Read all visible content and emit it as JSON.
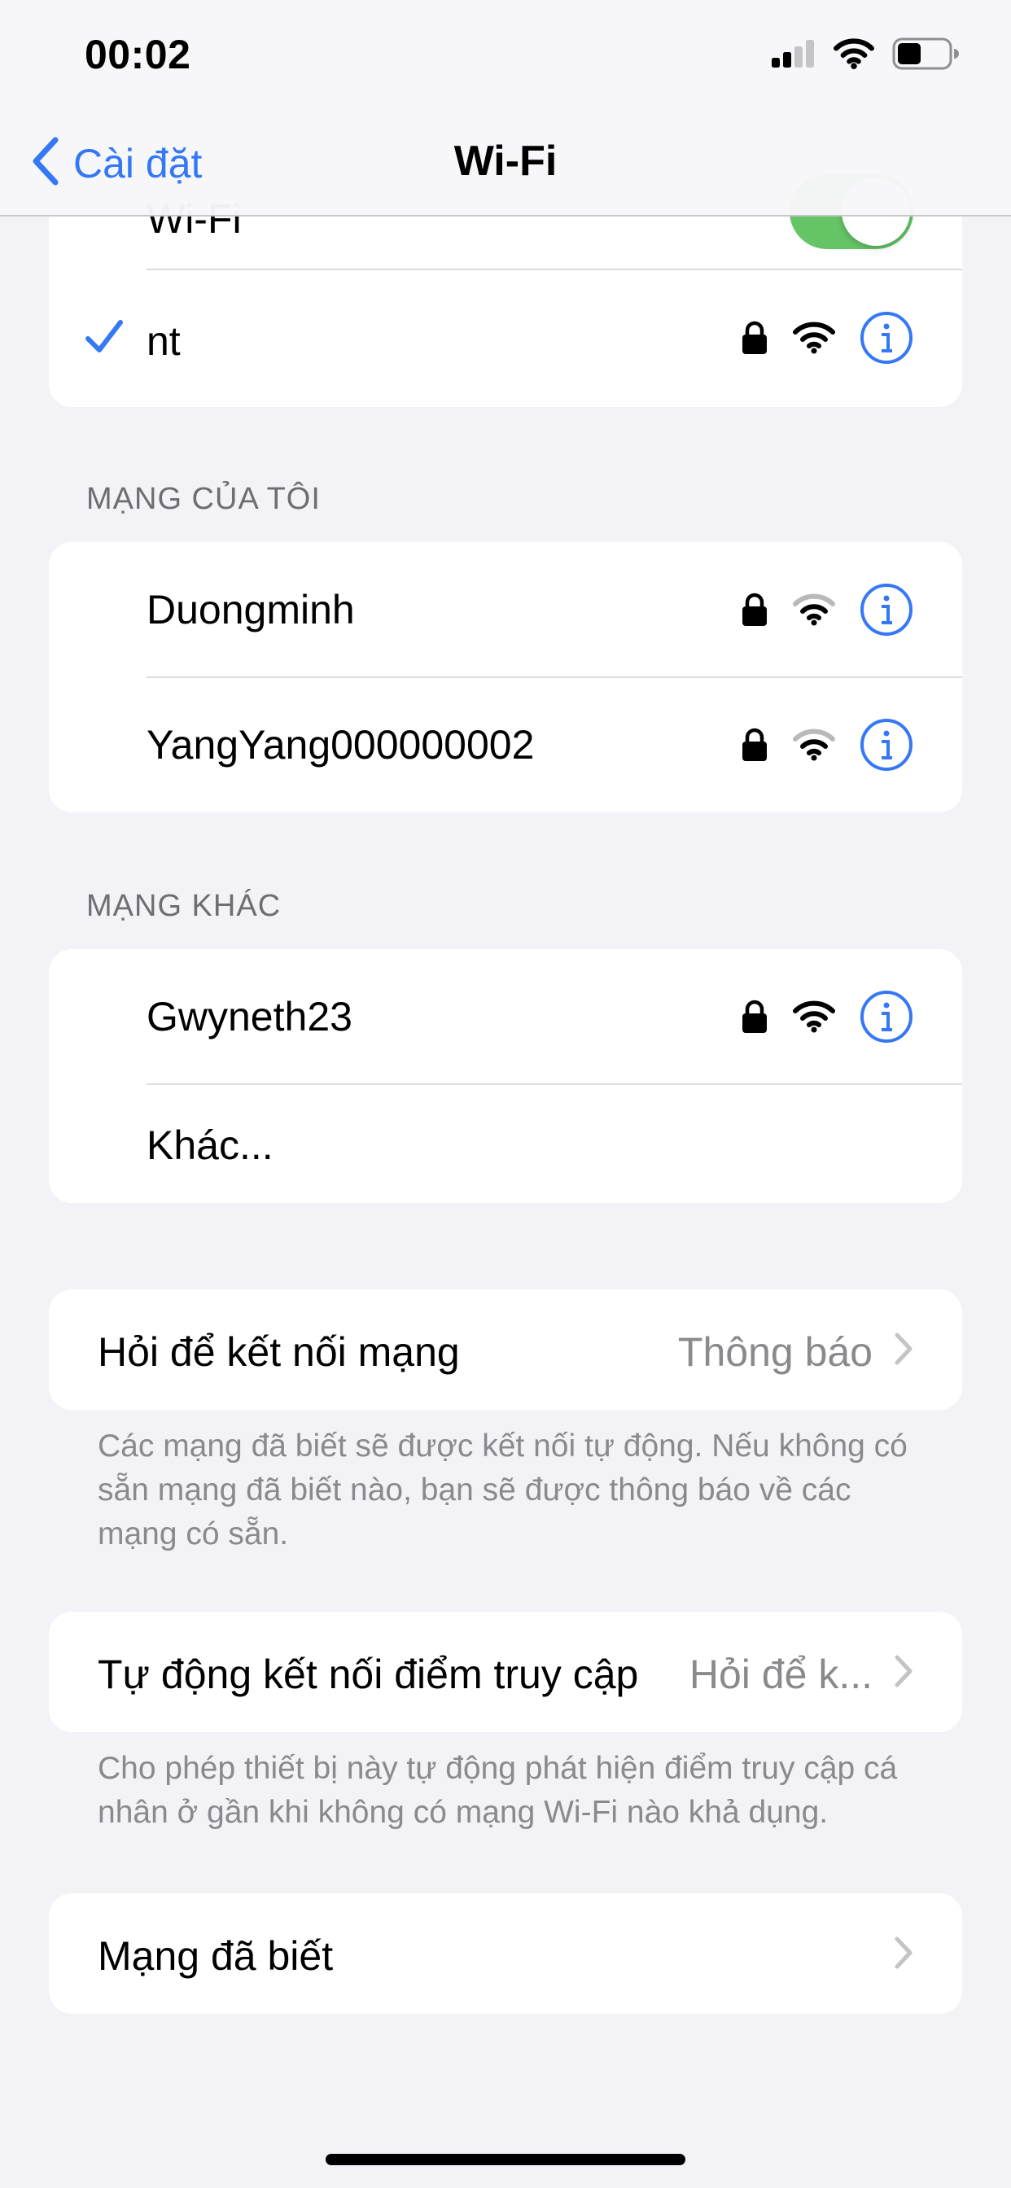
{
  "status_bar": {
    "time": "00:02"
  },
  "nav": {
    "back_label": "Cài đặt",
    "title": "Wi-Fi"
  },
  "wifi_toggle": {
    "label": "Wi-Fi",
    "on": true
  },
  "connected": {
    "name": "nt",
    "locked": true
  },
  "my_networks": {
    "header": "MẠNG CỦA TÔI",
    "items": [
      {
        "name": "Duongminh",
        "locked": true
      },
      {
        "name": "YangYang000000002",
        "locked": true
      }
    ]
  },
  "other_networks": {
    "header": "MẠNG KHÁC",
    "items": [
      {
        "name": "Gwyneth23",
        "locked": true
      }
    ],
    "other_label": "Khác..."
  },
  "ask_to_join": {
    "label": "Hỏi để kết nối mạng",
    "value": "Thông báo",
    "footnote": "Các mạng đã biết sẽ được kết nối tự động. Nếu không có sẵn mạng đã biết nào, bạn sẽ được thông báo về các mạng có sẵn."
  },
  "auto_join_hotspot": {
    "label": "Tự động kết nối điểm truy cập",
    "value": "Hỏi để k...",
    "footnote": "Cho phép thiết bị này tự động phát hiện điểm truy cập cá nhân ở gần khi không có mạng Wi-Fi nào khả dụng."
  },
  "known_networks": {
    "label": "Mạng đã biết"
  },
  "colors": {
    "accent": "#3478f6",
    "toggle_on": "#65c466",
    "background": "#f2f2f7"
  }
}
